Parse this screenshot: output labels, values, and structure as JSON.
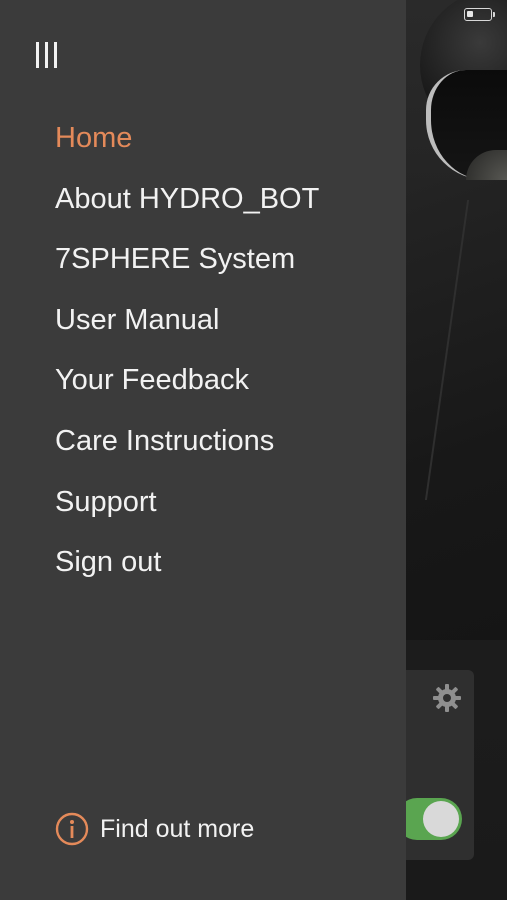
{
  "status_bar": {
    "battery_icon": "battery-low-icon",
    "battery_level": 0.2
  },
  "drawer": {
    "menu_icon": "hamburger-menu-icon",
    "items": [
      {
        "label": "Home",
        "active": true
      },
      {
        "label": "About HYDRO_BOT",
        "active": false
      },
      {
        "label": "7SPHERE System",
        "active": false
      },
      {
        "label": "User Manual",
        "active": false
      },
      {
        "label": "Your Feedback",
        "active": false
      },
      {
        "label": "Care Instructions",
        "active": false
      },
      {
        "label": "Support",
        "active": false
      },
      {
        "label": "Sign out",
        "active": false
      }
    ],
    "footer": {
      "icon": "info-circle-icon",
      "label": "Find out more"
    }
  },
  "background_app": {
    "settings_icon": "gear-icon",
    "toggle_on": true
  },
  "colors": {
    "drawer_bg": "#3b3b3b",
    "accent": "#e48a5a",
    "text": "#f2f2f2",
    "toggle_on": "#5aa550"
  }
}
